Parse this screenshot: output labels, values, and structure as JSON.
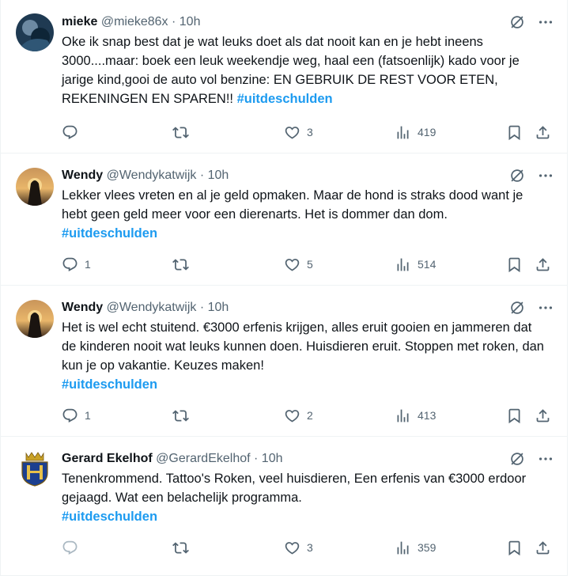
{
  "tweets": [
    {
      "name": "mieke",
      "handle": "@mieke86x",
      "time": "10h",
      "text": "Oke ik snap best dat je wat leuks doet als dat nooit kan en je hebt ineens 3000....maar: boek een leuk weekendje weg, haal een (fatsoenlijk) kado voor je jarige kind,gooi de auto vol benzine: EN GEBRUIK DE REST VOOR ETEN, REKENINGEN EN SPAREN!! ",
      "hashtag": "#uitdeschulden",
      "replies": "",
      "retweets": "",
      "likes": "3",
      "views": "419"
    },
    {
      "name": "Wendy",
      "handle": "@Wendykatwijk",
      "time": "10h",
      "text": "Lekker vlees vreten en al je geld opmaken. Maar de hond is straks dood want je hebt geen geld meer voor een dierenarts. Het is dommer dan dom.",
      "hashtag": "#uitdeschulden",
      "replies": "1",
      "retweets": "",
      "likes": "5",
      "views": "514"
    },
    {
      "name": "Wendy",
      "handle": "@Wendykatwijk",
      "time": "10h",
      "text": "Het is wel echt stuitend. €3000 erfenis krijgen, alles eruit gooien en jammeren dat de kinderen nooit wat leuks kunnen doen. Huisdieren eruit. Stoppen met roken, dan kun je op vakantie. Keuzes maken!",
      "hashtag": "#uitdeschulden",
      "replies": "1",
      "retweets": "",
      "likes": "2",
      "views": "413"
    },
    {
      "name": "Gerard Ekelhof",
      "handle": "@GerardEkelhof",
      "time": "10h",
      "text": "Tenenkrommend. Tattoo's Roken, veel huisdieren, Een erfenis van €3000 erdoor gejaagd. Wat een belachelijk programma.",
      "hashtag": "#uitdeschulden",
      "replies": "",
      "retweets": "",
      "likes": "3",
      "views": "359"
    }
  ],
  "separator": "·",
  "colors": {
    "accent": "#1d9bf0",
    "muted": "#536471",
    "text": "#0f1419",
    "border": "#eff3f4"
  }
}
